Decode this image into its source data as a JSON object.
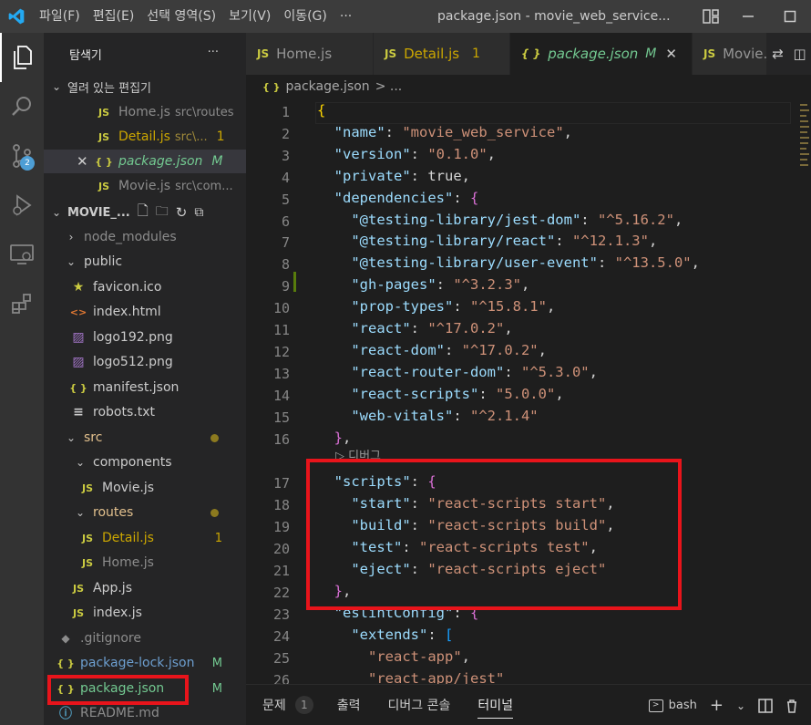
{
  "titlebar": {
    "menu": [
      "파일(F)",
      "편집(E)",
      "선택 영역(S)",
      "보기(V)",
      "이동(G)",
      "···"
    ],
    "title": "package.json - movie_web_service..."
  },
  "activity": {
    "scm_badge": "2"
  },
  "sidebar": {
    "title": "탐색기",
    "open_editors_label": "열려 있는 편집기",
    "open_editors": [
      {
        "icon": "JS",
        "name": "Home.js",
        "desc": "src\\routes",
        "status": ""
      },
      {
        "icon": "JS",
        "name": "Detail.js",
        "desc": "src\\...",
        "status": "1"
      },
      {
        "icon": "{ }",
        "name": "package.json",
        "desc": "",
        "status": "M"
      },
      {
        "icon": "JS",
        "name": "Movie.js",
        "desc": "src\\com...",
        "status": ""
      }
    ],
    "project_label": "MOVIE_...",
    "tree": [
      {
        "icon": "",
        "name": "node_modules",
        "status": ""
      },
      {
        "icon": "",
        "name": "public",
        "status": ""
      },
      {
        "icon": "★",
        "name": "favicon.ico",
        "status": ""
      },
      {
        "icon": "<>",
        "name": "index.html",
        "status": ""
      },
      {
        "icon": "▨",
        "name": "logo192.png",
        "status": ""
      },
      {
        "icon": "▨",
        "name": "logo512.png",
        "status": ""
      },
      {
        "icon": "{ }",
        "name": "manifest.json",
        "status": ""
      },
      {
        "icon": "≡",
        "name": "robots.txt",
        "status": ""
      },
      {
        "icon": "",
        "name": "src",
        "status": ""
      },
      {
        "icon": "",
        "name": "components",
        "status": ""
      },
      {
        "icon": "JS",
        "name": "Movie.js",
        "status": ""
      },
      {
        "icon": "",
        "name": "routes",
        "status": ""
      },
      {
        "icon": "JS",
        "name": "Detail.js",
        "status": "1"
      },
      {
        "icon": "JS",
        "name": "Home.js",
        "status": ""
      },
      {
        "icon": "JS",
        "name": "App.js",
        "status": ""
      },
      {
        "icon": "JS",
        "name": "index.js",
        "status": ""
      },
      {
        "icon": "◆",
        "name": ".gitignore",
        "status": ""
      },
      {
        "icon": "{ }",
        "name": "package-lock.json",
        "status": "M"
      },
      {
        "icon": "{ }",
        "name": "package.json",
        "status": "M"
      },
      {
        "icon": "ⓘ",
        "name": "README.md",
        "status": ""
      }
    ]
  },
  "tabs": [
    {
      "icon": "JS",
      "label": "Home.js",
      "extra": ""
    },
    {
      "icon": "JS",
      "label": "Detail.js",
      "extra": "1"
    },
    {
      "icon": "{ }",
      "label": "package.json",
      "extra": "M"
    },
    {
      "icon": "JS",
      "label": "Movie.j",
      "extra": ""
    }
  ],
  "breadcrumb": {
    "icon": "{ }",
    "file": "package.json",
    "sep": "> ..."
  },
  "editor": {
    "codelens": "▷ 디버그",
    "line_numbers": [
      "1",
      "2",
      "3",
      "4",
      "5",
      "6",
      "7",
      "8",
      "9",
      "10",
      "11",
      "12",
      "13",
      "14",
      "15",
      "16",
      "17",
      "18",
      "19",
      "20",
      "21",
      "22",
      "23",
      "24",
      "25",
      "26"
    ],
    "lines": [
      "{",
      "  \"name\": \"movie_web_service\",",
      "  \"version\": \"0.1.0\",",
      "  \"private\": true,",
      "  \"dependencies\": {",
      "    \"@testing-library/jest-dom\": \"^5.16.2\",",
      "    \"@testing-library/react\": \"^12.1.3\",",
      "    \"@testing-library/user-event\": \"^13.5.0\",",
      "    \"gh-pages\": \"^3.2.3\",",
      "    \"prop-types\": \"^15.8.1\",",
      "    \"react\": \"^17.0.2\",",
      "    \"react-dom\": \"^17.0.2\",",
      "    \"react-router-dom\": \"^5.3.0\",",
      "    \"react-scripts\": \"5.0.0\",",
      "    \"web-vitals\": \"^2.1.4\"",
      "  },",
      "  \"scripts\": {",
      "    \"start\": \"react-scripts start\",",
      "    \"build\": \"react-scripts build\",",
      "    \"test\": \"react-scripts test\",",
      "    \"eject\": \"react-scripts eject\"",
      "  },",
      "  \"eslintConfig\": {",
      "    \"extends\": [",
      "      \"react-app\",",
      "      \"react-app/jest\""
    ]
  },
  "panel": {
    "tabs": [
      "문제",
      "출력",
      "디버그 콘솔",
      "터미널"
    ],
    "problems_count": "1",
    "shell": "bash"
  }
}
